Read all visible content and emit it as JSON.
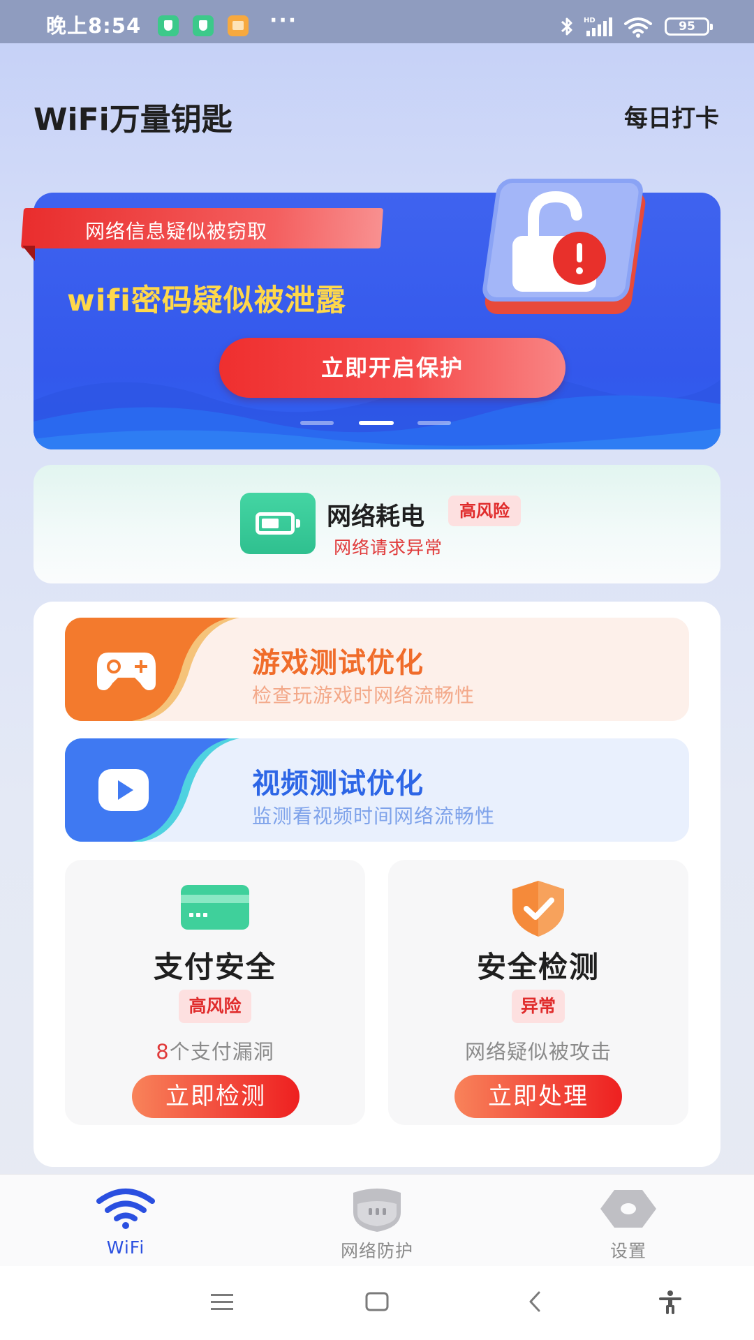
{
  "status_bar": {
    "time": "晚上8:54",
    "dots": "···",
    "network": "HD",
    "battery": "95"
  },
  "header": {
    "title": "WiFi万量钥匙",
    "checkin_label": "每日打卡"
  },
  "banner": {
    "ribbon_text": "网络信息疑似被窃取",
    "headline": "wifi密码疑似被泄露",
    "button_label": "立即开启保护",
    "page_indicator": {
      "count": 3,
      "active": 2
    },
    "colors": {
      "background": "#3358ec",
      "headline": "#ffd84a",
      "button": "#ef2f2f"
    }
  },
  "power_card": {
    "title": "网络耗电",
    "badge": "高风险",
    "subtitle": "网络请求异常",
    "icon": "battery-icon"
  },
  "options": [
    {
      "title": "游戏测试优化",
      "subtitle": "检查玩游戏时网络流畅性",
      "icon": "gamepad-icon",
      "accent": "#f06c2a"
    },
    {
      "title": "视频测试优化",
      "subtitle": "监测看视频时间网络流畅性",
      "icon": "play-icon",
      "accent": "#2d66e6"
    }
  ],
  "tiles": [
    {
      "title": "支付安全",
      "badge": "高风险",
      "desc_num": "8",
      "desc_text": "个支付漏洞",
      "button_label": "立即检测",
      "icon": "card-icon"
    },
    {
      "title": "安全检测",
      "badge": "异常",
      "desc_num": "",
      "desc_text": "网络疑似被攻击",
      "button_label": "立即处理",
      "icon": "shield-check-icon"
    }
  ],
  "bottom_nav": {
    "items": [
      {
        "label": "WiFi",
        "icon": "wifi-icon",
        "active": true
      },
      {
        "label": "网络防护",
        "icon": "shield-icon",
        "active": false
      },
      {
        "label": "设置",
        "icon": "settings-icon",
        "active": false
      }
    ],
    "active_color": "#2a4fe0"
  },
  "system_nav": [
    "menu-icon",
    "home-icon",
    "back-icon",
    "accessibility-icon"
  ]
}
